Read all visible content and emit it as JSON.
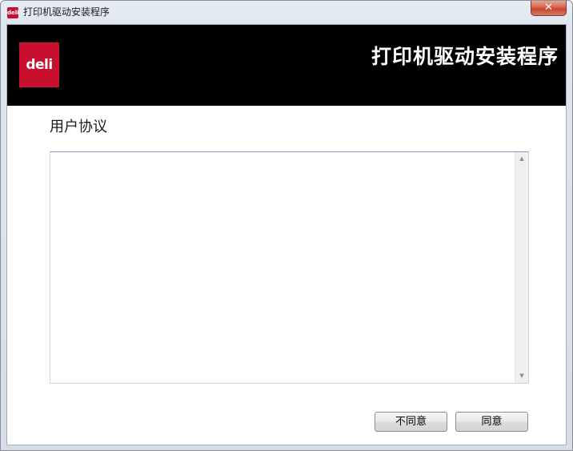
{
  "window": {
    "title": "打印机驱动安装程序",
    "title_icon_text": "deli",
    "close_symbol": "✕"
  },
  "banner": {
    "logo_text": "deli",
    "title": "打印机驱动安装程序"
  },
  "agreement": {
    "heading": "用户协议",
    "text": "",
    "scroll_up_glyph": "▲",
    "scroll_down_glyph": "▼"
  },
  "buttons": {
    "disagree_label": "不同意",
    "agree_label": "同意"
  },
  "colors": {
    "brand_red": "#c8102e",
    "banner_bg": "#000000"
  }
}
